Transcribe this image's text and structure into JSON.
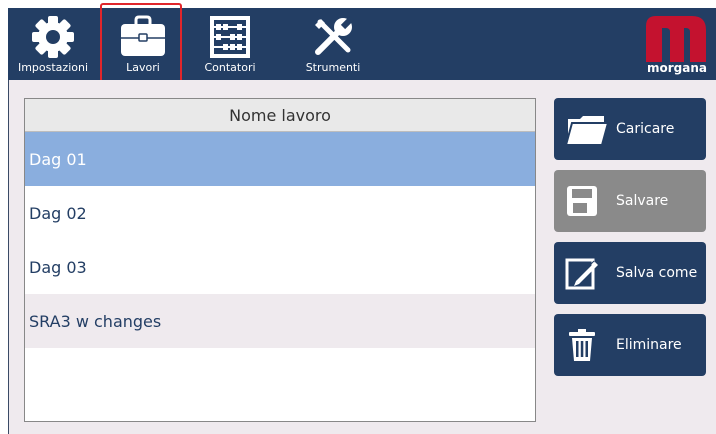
{
  "nav": {
    "items": [
      {
        "label": "Impostazioni",
        "icon": "gear-icon"
      },
      {
        "label": "Lavori",
        "icon": "briefcase-icon",
        "active": true
      },
      {
        "label": "Contatori",
        "icon": "abacus-icon"
      },
      {
        "label": "Strumenti",
        "icon": "tools-icon"
      }
    ],
    "logo_text": "morgana"
  },
  "jobs": {
    "header": "Nome lavoro",
    "rows": [
      "Dag 01",
      "Dag 02",
      "Dag 03",
      "SRA3 w changes"
    ],
    "selected_index": 0
  },
  "actions": {
    "load_label": "Caricare",
    "save_label": "Salvare",
    "save_as_label": "Salva come",
    "delete_label": "Eliminare"
  },
  "colors": {
    "navy": "#233e64",
    "selected_row": "#8aaede",
    "disabled_button": "#8a8a8a",
    "active_outline": "#e0262b",
    "brand_red": "#c4122f"
  }
}
